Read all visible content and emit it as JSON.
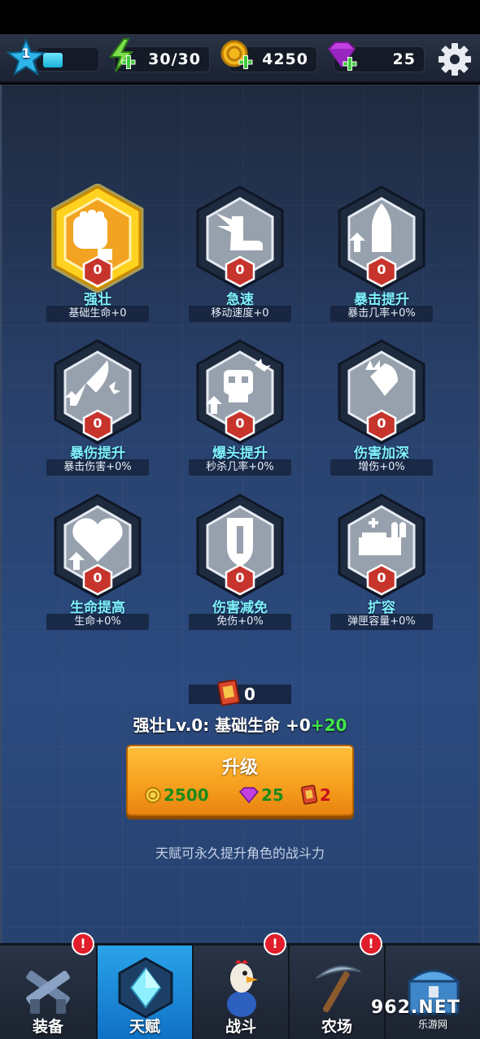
{
  "hud": {
    "level": "1",
    "xp_progress": 0.4,
    "energy": "30/30",
    "coins": "4250",
    "gems": "25"
  },
  "talents": [
    {
      "name": "强壮",
      "desc": "基础生命+0",
      "level": "0",
      "icon": "fist-icon",
      "selected": true
    },
    {
      "name": "急速",
      "desc": "移动速度+0",
      "level": "0",
      "icon": "winged-boot-icon",
      "selected": false
    },
    {
      "name": "暴击提升",
      "desc": "暴击几率+0%",
      "level": "0",
      "icon": "bullet-up-icon",
      "selected": false
    },
    {
      "name": "暴伤提升",
      "desc": "暴击伤害+0%",
      "level": "0",
      "icon": "rocket-icon",
      "selected": false
    },
    {
      "name": "爆头提升",
      "desc": "秒杀几率+0%",
      "level": "0",
      "icon": "skull-up-icon",
      "selected": false
    },
    {
      "name": "伤害加深",
      "desc": "增伤+0%",
      "level": "0",
      "icon": "burst-bullet-icon",
      "selected": false
    },
    {
      "name": "生命提高",
      "desc": "生命+0%",
      "level": "0",
      "icon": "heart-up-icon",
      "selected": false
    },
    {
      "name": "伤害减免",
      "desc": "免伤+0%",
      "level": "0",
      "icon": "shield-icon",
      "selected": false
    },
    {
      "name": "扩容",
      "desc": "弹匣容量+0%",
      "level": "0",
      "icon": "ammo-box-icon",
      "selected": false
    }
  ],
  "book_count": "0",
  "selected": {
    "prefix": "强壮Lv.0: 基础生命 +0",
    "bonus": "+20"
  },
  "upgrade": {
    "label": "升级",
    "cost_coins": "2500",
    "cost_gems": "25",
    "cost_books": "2"
  },
  "tip": "天赋可永久提升角色的战斗力",
  "tabs": [
    {
      "label": "装备",
      "alert": "!"
    },
    {
      "label": "天赋",
      "alert": ""
    },
    {
      "label": "战斗",
      "alert": "!"
    },
    {
      "label": "农场",
      "alert": "!"
    },
    {
      "label": "",
      "alert": ""
    }
  ],
  "watermark": {
    "text": "962.NET",
    "sub": "乐游网"
  },
  "colors": {
    "accent": "#7ff3ff",
    "selected_hex": "#f2a322",
    "tab_active": "#1f8ddc",
    "bonus_green": "#44e84a"
  }
}
